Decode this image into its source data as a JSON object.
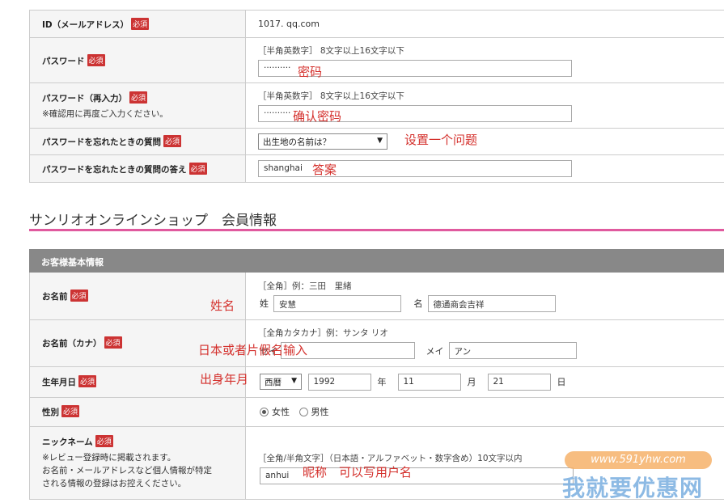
{
  "required_badge": "必須",
  "account": {
    "rows": [
      {
        "label": "ID（メールアドレス）",
        "value": "1017.         qq.com"
      },
      {
        "label": "パスワード",
        "hint": "［半角英数字］ 8文字以上16文字以下",
        "value": "··········",
        "annotation": "密码"
      },
      {
        "label": "パスワード（再入力）",
        "note": "※確認用に再度ご入力ください。",
        "hint": "［半角英数字］ 8文字以上16文字以下",
        "value": "··········",
        "annotation": "确认密码"
      },
      {
        "label": "パスワードを忘れたときの質問",
        "value": "出生地の名前は？",
        "annotation": "设置一个问题"
      },
      {
        "label": "パスワードを忘れたときの質問の答え",
        "value": "shanghai",
        "annotation": "答案"
      }
    ]
  },
  "section": {
    "title": "サンリオオンラインショップ　会員情報",
    "subheading": "お客様基本情報"
  },
  "member": {
    "name": {
      "label": "お名前",
      "hint": "［全角］例：三田　里緒",
      "sei_label": "姓",
      "sei_value": "安慧",
      "mei_label": "名",
      "mei_value": "德通商会吉祥",
      "annotation": "姓名"
    },
    "kana": {
      "label": "お名前（カナ）",
      "hint": "［全角カタカナ］例：サンタ リオ",
      "sei_label": "セイ",
      "sei_value": "",
      "mei_label": "メイ",
      "mei_value": "アン",
      "annotation": "日本或者片假名输入"
    },
    "birth": {
      "label": "生年月日",
      "era": "西暦",
      "year": "1992",
      "year_unit": "年",
      "month": "11",
      "month_unit": "月",
      "day": "21",
      "day_unit": "日",
      "annotation": "出身年月"
    },
    "gender": {
      "label": "性別",
      "female": "女性",
      "male": "男性"
    },
    "nickname": {
      "label": "ニックネーム",
      "note1": "※レビュー登録時に掲載されます。",
      "note2": "お名前・メールアドレスなど個人情報が特定",
      "note3": "される情報の登録はお控えください。",
      "hint": "［全角/半角文字］（日本語・アルファベット・数字含め）10文字以内",
      "value": "anhui",
      "annotation": "昵称　可以写用户名"
    }
  },
  "watermark": {
    "url": "www.591yhw.com",
    "text": "我就要优惠网"
  }
}
